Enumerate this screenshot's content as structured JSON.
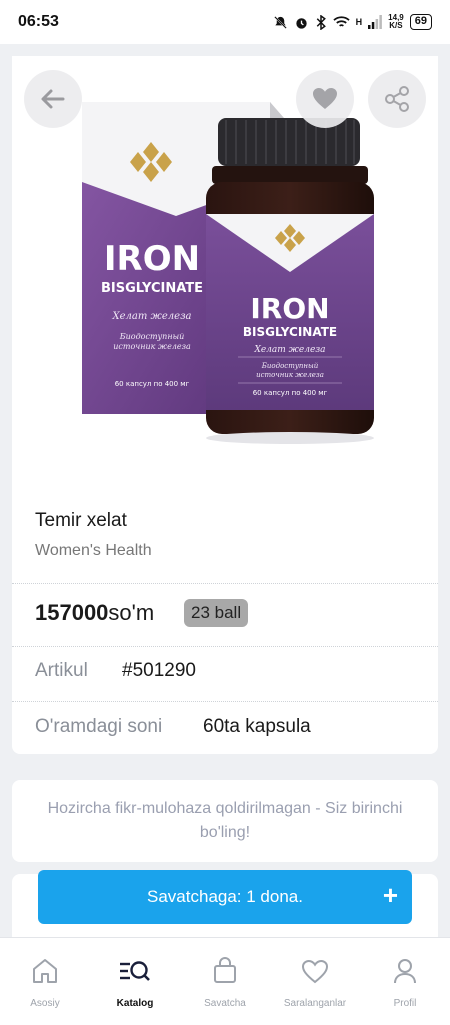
{
  "status_bar": {
    "time": "06:53",
    "net_speed_value": "14,9",
    "net_speed_unit": "K/S",
    "network_letter": "H",
    "battery": "69"
  },
  "colors": {
    "accent": "#1aa3ec",
    "badge_bg": "#a8a8a8",
    "muted_text": "#8a8f98",
    "product_purple": "#6a3f86"
  },
  "product": {
    "image": {
      "brand_main": "IRON",
      "brand_sub": "BISGLYCINATE",
      "ru_title": "Хелат железа",
      "ru_desc_1": "Биодоступный",
      "ru_desc_2": "источник железа",
      "ru_caps": "60 капсул по 400 мг"
    },
    "title": "Temir xelat",
    "category": "Women's Health",
    "price_value": "157000",
    "price_currency": "so'm",
    "ball": "23 ball",
    "article_label": "Artikul",
    "article_value": "#501290",
    "pack_label": "O'ramdagi soni",
    "pack_value": "60ta kapsula"
  },
  "actions": {
    "back_icon": "arrow-left-icon",
    "favorite_icon": "heart-icon",
    "share_icon": "share-icon"
  },
  "reviews": {
    "empty_text": "Hozircha fikr-mulohaza qoldirilmagan - Siz birinchi bo'ling!"
  },
  "cart": {
    "label": "Savatchaga: 1 dona.",
    "plus": "+"
  },
  "nav": {
    "items": [
      {
        "label": "Asosiy",
        "icon": "home-icon"
      },
      {
        "label": "Katalog",
        "icon": "catalog-search-icon",
        "active": true
      },
      {
        "label": "Savatcha",
        "icon": "shopping-bag-icon"
      },
      {
        "label": "Saralanganlar",
        "icon": "heart-outline-icon"
      },
      {
        "label": "Profil",
        "icon": "user-icon"
      }
    ]
  }
}
